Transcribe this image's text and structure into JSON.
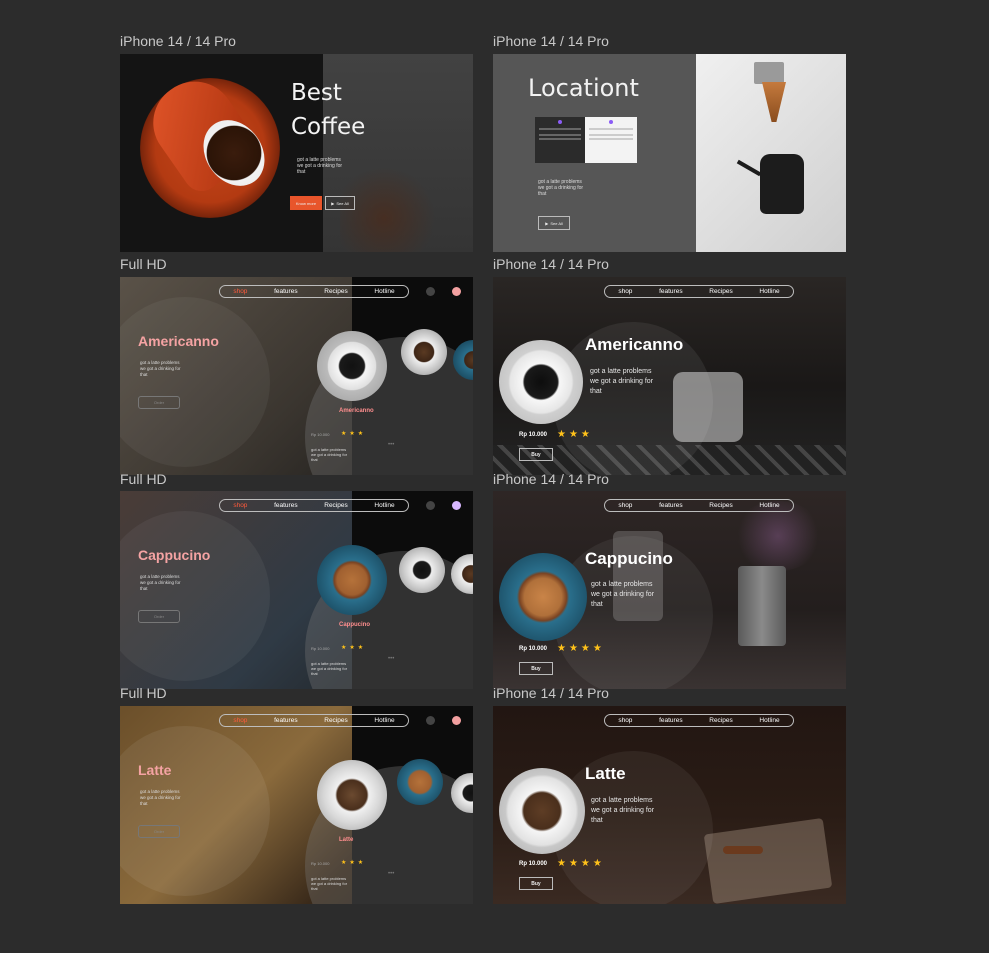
{
  "labels": {
    "best_coffee": "iPhone 14 / 14 Pro",
    "location": "iPhone 14 / 14 Pro",
    "fhd_americanno": "Full HD",
    "iphone_americanno": "iPhone 14 / 14 Pro",
    "fhd_cappucino": "Full HD",
    "iphone_cappucino": "iPhone 14 / 14 Pro",
    "fhd_latte": "Full HD",
    "iphone_latte": "iPhone 14 / 14 Pro"
  },
  "hero": {
    "title_line1": "Best",
    "title_line2": "Coffee",
    "desc_line1": "got a latte problems",
    "desc_line2": "we got a drinking for",
    "desc_line3": "that",
    "primary_button": "Know more",
    "secondary_button": "See All"
  },
  "location": {
    "title": "Locationt",
    "desc_line1": "got a latte problems",
    "desc_line2": "we got a drinking for",
    "desc_line3": "that",
    "button": "See All"
  },
  "nav": {
    "shop": "shop",
    "features": "features",
    "recipes": "Recipes",
    "hotline": "Hotline"
  },
  "product": {
    "desc_line1": "got a latte problems",
    "desc_line2": "we got a drinking for",
    "desc_line3": "that",
    "price": "Rp 10.000",
    "buy": "Buy",
    "order": "Order",
    "stars3": "★★★",
    "stars4": "★★★★",
    "dots": "•••"
  },
  "americanno": {
    "name": "Americanno"
  },
  "cappucino": {
    "name": "Cappucino"
  },
  "latte": {
    "name": "Latte"
  },
  "colors": {
    "accent_orange": "#e8552b",
    "pink_title": "#f5a3a3",
    "star": "#ffc21a",
    "background": "#2c2c2c"
  }
}
